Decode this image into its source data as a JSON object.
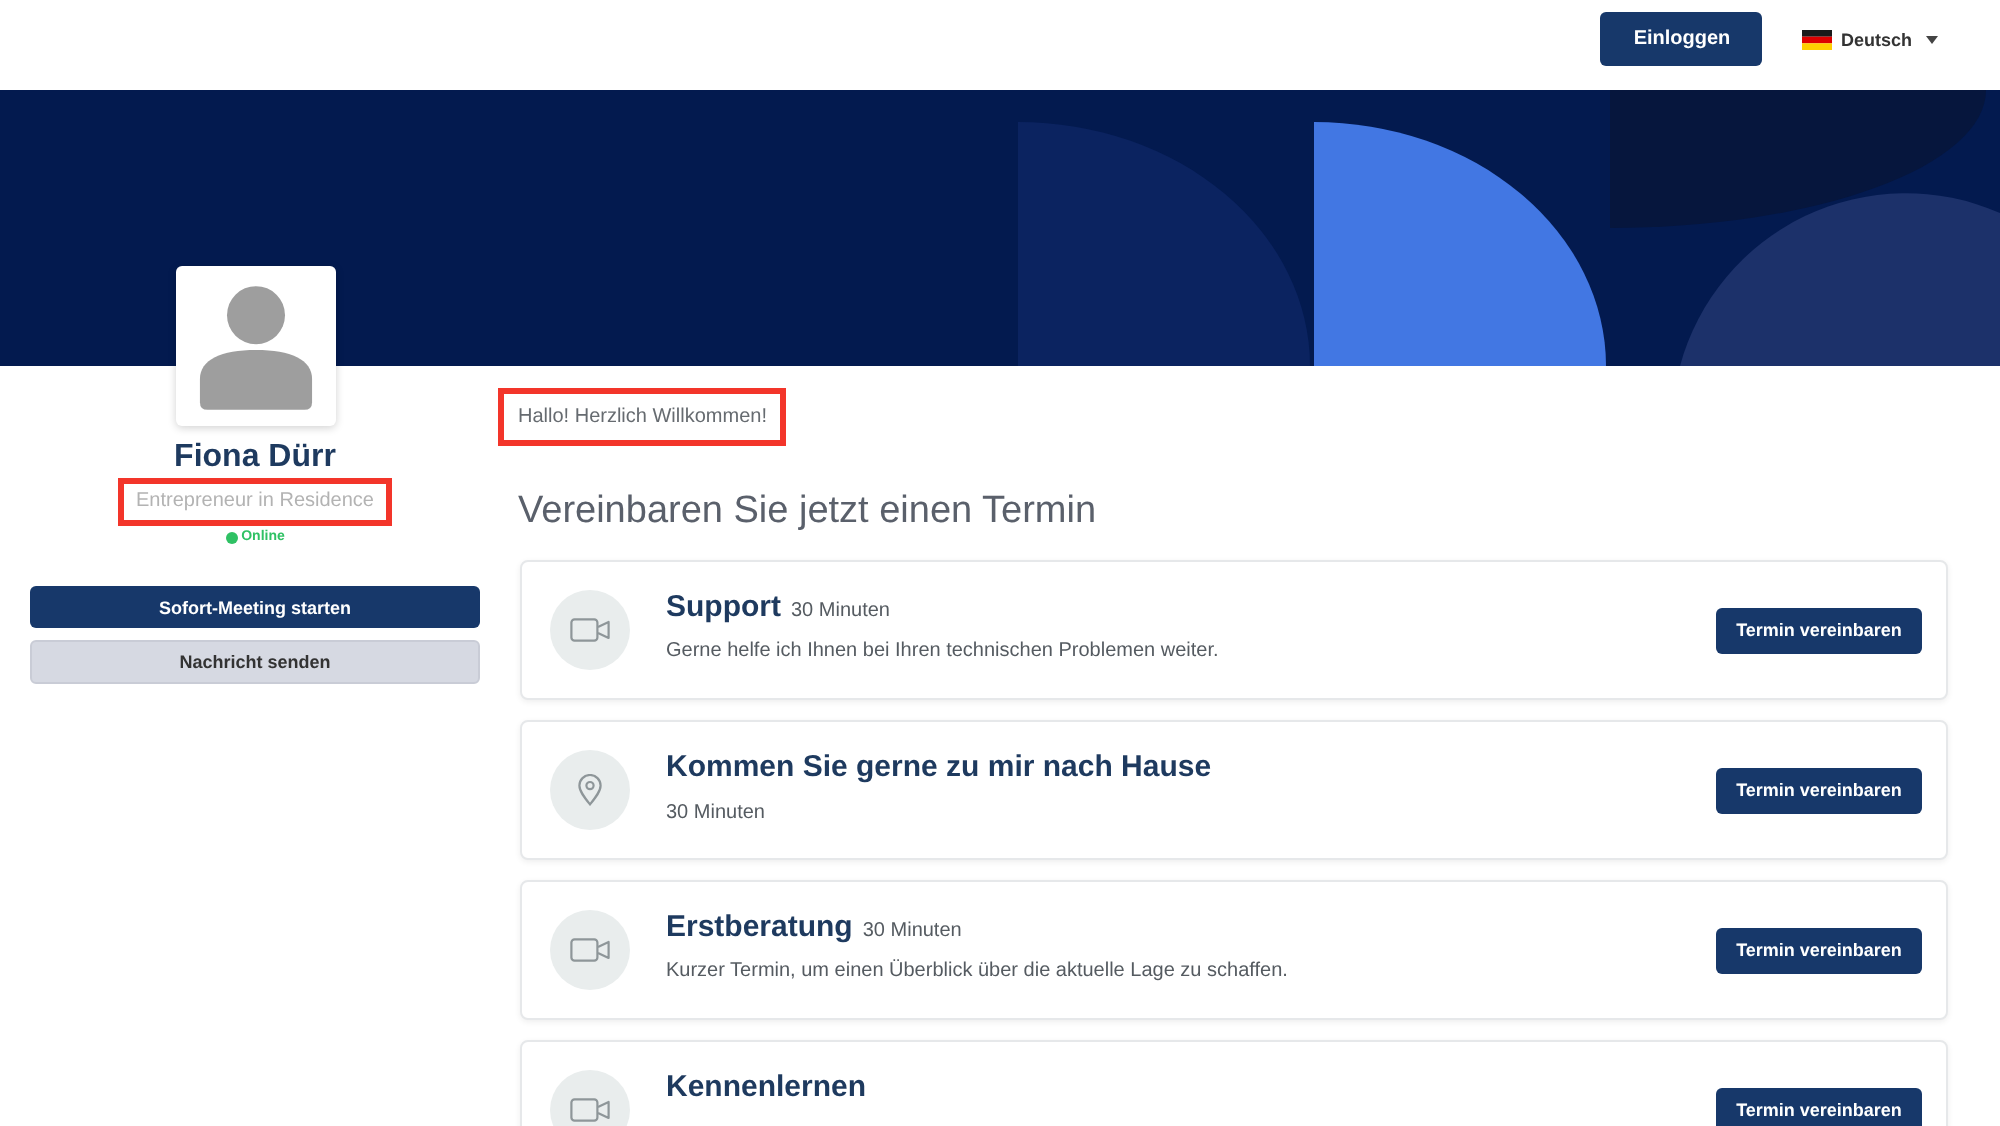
{
  "header": {
    "login_button": "Einloggen",
    "language": {
      "label": "Deutsch"
    }
  },
  "profile": {
    "name": "Fiona Dürr",
    "title": {
      "text": "Entrepreneur in Residence",
      "highlighted": true
    },
    "status": {
      "label": "Online",
      "online": true
    },
    "buttons": [
      {
        "label": "Sofort-Meeting starten",
        "kind": "primary"
      },
      {
        "label": "Nachricht senden",
        "kind": "secondary"
      }
    ]
  },
  "greeting": {
    "text": "Hallo! Herzlich Willkommen!",
    "highlighted": true
  },
  "heading": "Vereinbaren Sie jetzt einen Termin",
  "appointments": [
    {
      "kind": "video",
      "title": "Support",
      "duration": "30 Minuten",
      "description": "Gerne helfe ich Ihnen bei Ihren technischen Problemen weiter.",
      "button": "Termin vereinbaren"
    },
    {
      "kind": "location",
      "title": "Kommen Sie gerne zu mir nach Hause",
      "duration": "30 Minuten",
      "button": "Termin vereinbaren"
    },
    {
      "kind": "video",
      "title": "Erstberatung",
      "duration": "30 Minuten",
      "description": "Kurzer Termin, um einen Überblick über die aktuelle Lage zu schaffen.",
      "button": "Termin vereinbaren"
    },
    {
      "kind": "video",
      "title": "Kennenlernen",
      "button": "Termin vereinbaren"
    }
  ]
}
